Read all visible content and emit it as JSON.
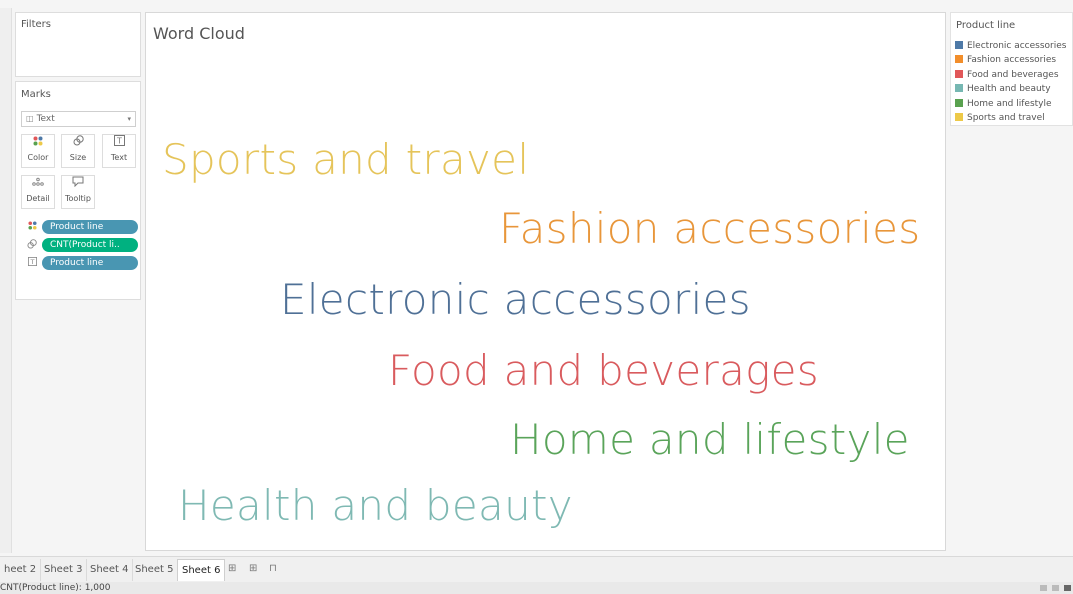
{
  "filters": {
    "title": "Filters"
  },
  "marks": {
    "title": "Marks",
    "type_select": {
      "icon": "text-mark-icon",
      "value": "Text"
    },
    "buttons": [
      {
        "label": "Color",
        "icon": "color-dots-icon"
      },
      {
        "label": "Size",
        "icon": "size-icon"
      },
      {
        "label": "Text",
        "icon": "text-box-icon"
      },
      {
        "label": "Detail",
        "icon": "detail-dots-icon"
      },
      {
        "label": "Tooltip",
        "icon": "tooltip-icon"
      }
    ],
    "pills": [
      {
        "icon": "color-dots-icon",
        "label": "Product line",
        "color": "#4996b2"
      },
      {
        "icon": "size-icon",
        "label": "CNT(Product li..",
        "color": "#00b180"
      },
      {
        "icon": "text-box-icon",
        "label": "Product line",
        "color": "#4996b2"
      }
    ]
  },
  "canvas": {
    "title": "Word Cloud"
  },
  "word_cloud": [
    {
      "text": "Sports and travel",
      "color": "#e5c45a"
    },
    {
      "text": "Fashion accessories",
      "color": "#e8963a"
    },
    {
      "text": "Electronic accessories",
      "color": "#4f7096"
    },
    {
      "text": "Food and beverages",
      "color": "#d95b5e"
    },
    {
      "text": "Home and lifestyle",
      "color": "#5aa45a"
    },
    {
      "text": "Health and beauty",
      "color": "#7fb9b3"
    }
  ],
  "legend": {
    "title": "Product line",
    "items": [
      {
        "label": "Electronic accessories",
        "color": "#4e79a7"
      },
      {
        "label": "Fashion accessories",
        "color": "#f28e2b"
      },
      {
        "label": "Food and beverages",
        "color": "#e15759"
      },
      {
        "label": "Health and beauty",
        "color": "#76b7b2"
      },
      {
        "label": "Home and lifestyle",
        "color": "#59a14f"
      },
      {
        "label": "Sports and travel",
        "color": "#edc948"
      }
    ]
  },
  "tabs": [
    {
      "label": "heet 2"
    },
    {
      "label": "Sheet 3"
    },
    {
      "label": "Sheet 4"
    },
    {
      "label": "Sheet 5"
    },
    {
      "label": "Sheet 6",
      "active": true
    }
  ],
  "tab_actions": [
    {
      "icon": "new-worksheet-icon",
      "glyph": "⊞"
    },
    {
      "icon": "new-dashboard-icon",
      "glyph": "⊞"
    },
    {
      "icon": "new-story-icon",
      "glyph": "⊓"
    }
  ],
  "status": {
    "text": "CNT(Product line): 1,000"
  }
}
